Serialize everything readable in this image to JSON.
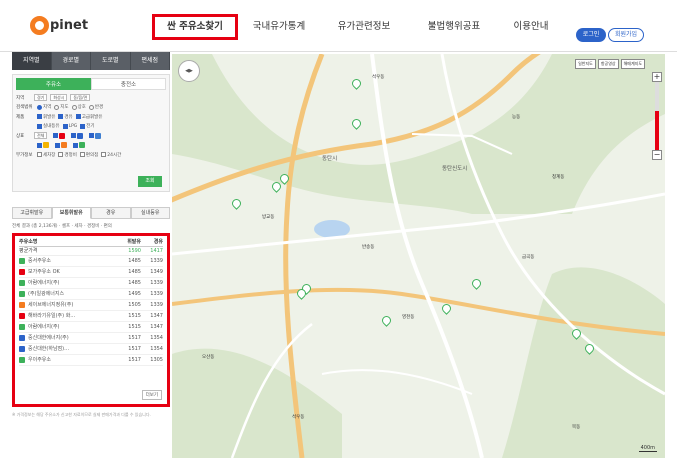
{
  "header": {
    "logo": "pinet",
    "nav": [
      {
        "label": "싼 주유소찾기",
        "active": true
      },
      {
        "label": "국내유가통계",
        "active": false
      },
      {
        "label": "유가관련정보",
        "active": false
      },
      {
        "label": "불법행위공표",
        "active": false
      },
      {
        "label": "이용안내",
        "active": false
      }
    ],
    "login": "로그인",
    "join": "회원가입"
  },
  "sidebar": {
    "top_tabs": [
      "지역별",
      "경로별",
      "도로별",
      "편세점"
    ],
    "sub_tabs": [
      "주유소",
      "충전소"
    ],
    "region_label": "지역",
    "region_sido": "경기",
    "region_sigungu": "화성시",
    "region_dong": "동/읍/면",
    "sort_label": "검색범위",
    "sort_options": [
      "지역",
      "지도",
      "상호",
      "반경"
    ],
    "fuel_label": "제품",
    "fuel_options": [
      "휘발유",
      "경유",
      "고급휘발유",
      "실내등유",
      "LPG",
      "전기"
    ],
    "brand_label": "상표",
    "brand_all": "전체",
    "extra_label": "부가정보",
    "extra_options": [
      "세차장",
      "경정비",
      "편의점",
      "24시간"
    ],
    "search_button": "조회",
    "result_tabs": [
      "고급휘발유",
      "보통휘발유",
      "경유",
      "실내등유"
    ],
    "legend": "전체 결과 (총 2,136개) · 셀프 · 세차 · 경정비 · 편의",
    "table": {
      "col_name": "주유소명",
      "col_gasoline": "휘발유",
      "col_diesel": "경유",
      "avg_label": "평균가격",
      "avg_gasoline": "1590",
      "avg_diesel": "1417"
    },
    "rows": [
      {
        "name": "중서주유소",
        "gasoline": "1485",
        "diesel": "1339",
        "brand_color": "#3db15a"
      },
      {
        "name": "보가주유소 OK",
        "gasoline": "1485",
        "diesel": "1349",
        "brand_color": "#e60012"
      },
      {
        "name": "아람에너지(주)",
        "gasoline": "1485",
        "diesel": "1339",
        "brand_color": "#3db15a"
      },
      {
        "name": "(주)일광에너지스",
        "gasoline": "1495",
        "diesel": "1339",
        "brand_color": "#3db15a"
      },
      {
        "name": "세이브에너지정유(주)",
        "gasoline": "1505",
        "diesel": "1339",
        "brand_color": "#f47c20"
      },
      {
        "name": "해바라기유일(주) 화…",
        "gasoline": "1515",
        "diesel": "1347",
        "brand_color": "#e60012"
      },
      {
        "name": "아람에너지(주)",
        "gasoline": "1515",
        "diesel": "1347",
        "brand_color": "#3db15a"
      },
      {
        "name": "중신대한에너지(주)",
        "gasoline": "1517",
        "diesel": "1354",
        "brand_color": "#2c63c9"
      },
      {
        "name": "중신대한(하남점)…",
        "gasoline": "1517",
        "diesel": "1354",
        "brand_color": "#2c63c9"
      },
      {
        "name": "우이주유소",
        "gasoline": "1517",
        "diesel": "1305",
        "brand_color": "#3db15a"
      }
    ],
    "more_button": "더보기",
    "note": "※ 가격정보는 해당 주유소가 신고한 자료이므로 실제 판매가격과 다를 수 있습니다."
  },
  "map": {
    "buttons": [
      "일반지도",
      "항공영상",
      "해매계지도"
    ],
    "zoom_level": 0.58,
    "scale": "400m",
    "places": [
      "석우동",
      "동탄시",
      "동탄신도시",
      "오산동",
      "능동",
      "반송동",
      "청계동",
      "영천동",
      "방교동",
      "금곡동",
      "석우동",
      "목동"
    ]
  }
}
